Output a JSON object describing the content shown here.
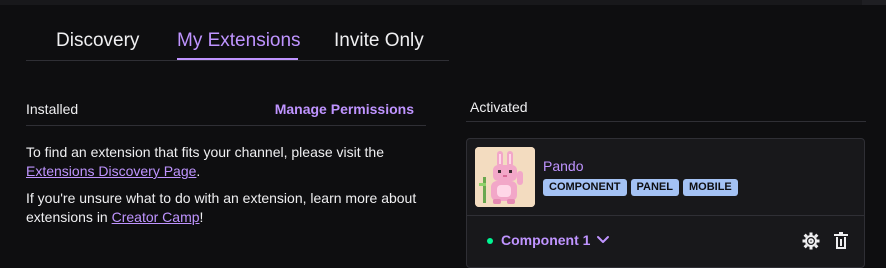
{
  "tabs": [
    {
      "label": "Discovery"
    },
    {
      "label": "My Extensions"
    },
    {
      "label": "Invite Only"
    }
  ],
  "installed": {
    "title": "Installed",
    "manage_permissions": "Manage Permissions",
    "text1_prefix": "To find an extension that fits your channel, please visit the ",
    "text1_link": "Extensions Discovery Page",
    "text1_suffix": ".",
    "text2_prefix": "If you're unsure what to do with an extension, learn more about extensions in ",
    "text2_link": "Creator Camp",
    "text2_suffix": "!"
  },
  "activated": {
    "title": "Activated",
    "extension": {
      "name": "Pando",
      "badges": [
        "COMPONENT",
        "PANEL",
        "MOBILE"
      ],
      "slot": "Component 1",
      "status_color": "#00f593"
    }
  },
  "colors": {
    "accent": "#bf94ff",
    "badge": "#a4c2f4",
    "background": "#0e0e10"
  },
  "icons": [
    "chevron-down-icon",
    "gear-icon",
    "trash-icon"
  ]
}
